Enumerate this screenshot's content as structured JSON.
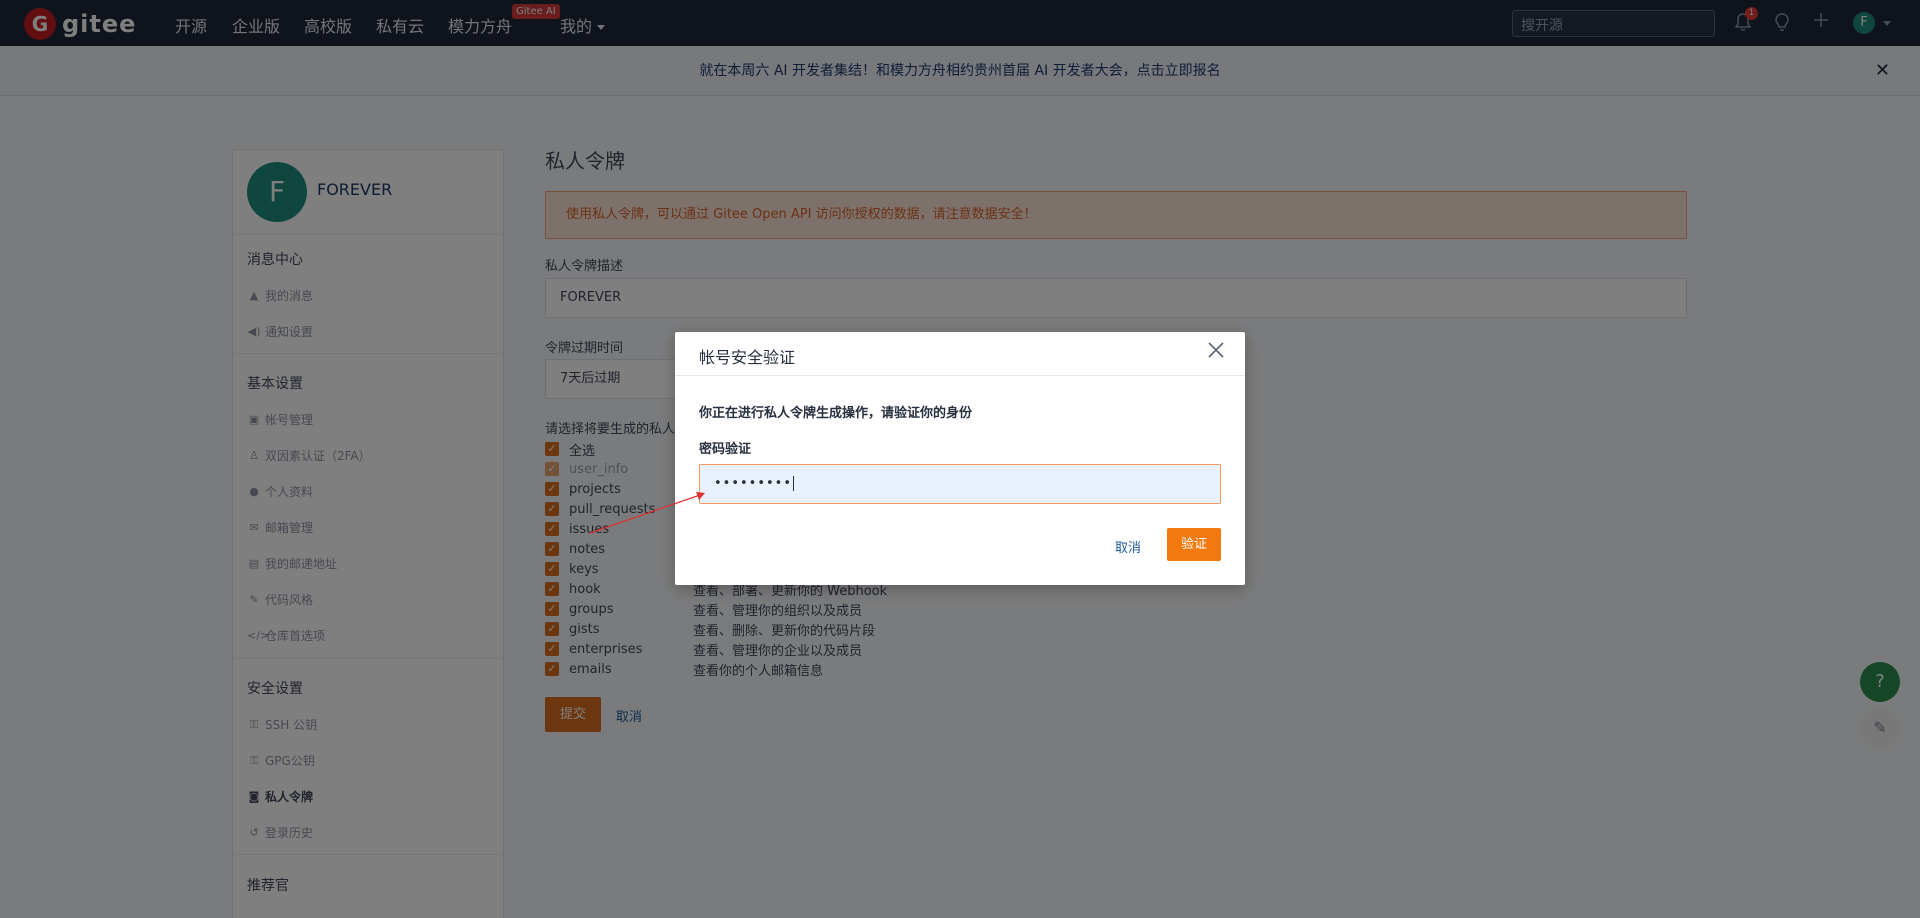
{
  "nav": {
    "logo_letter": "G",
    "logo_text": "gitee",
    "items": [
      "开源",
      "企业版",
      "高校版",
      "私有云",
      "模力方舟",
      "我的"
    ],
    "ai_badge": "Gitee AI",
    "search_placeholder": "搜开源",
    "notif_count": "1",
    "avatar_letter": "F"
  },
  "announcement": {
    "text": "就在本周六 AI 开发者集结！和模力方舟相约贵州首届 AI 开发者大会，点击立即报名",
    "close": "✕"
  },
  "sidebar": {
    "avatar_letter": "F",
    "username": "FOREVER",
    "sections": [
      {
        "title": "消息中心",
        "items": [
          {
            "icon": "bell-icon",
            "glyph": "🔔",
            "label": "我的消息"
          },
          {
            "icon": "speaker-icon",
            "glyph": "🔈",
            "label": "通知设置"
          }
        ]
      },
      {
        "title": "基本设置",
        "items": [
          {
            "icon": "id-card-icon",
            "glyph": "▣",
            "label": "帐号管理"
          },
          {
            "icon": "user-shield-icon",
            "glyph": "⚇",
            "label": "双因素认证（2FA）"
          },
          {
            "icon": "user-icon",
            "glyph": "●",
            "label": "个人资料"
          },
          {
            "icon": "mail-icon",
            "glyph": "✉",
            "label": "邮箱管理"
          },
          {
            "icon": "address-icon",
            "glyph": "▤",
            "label": "我的邮递地址"
          },
          {
            "icon": "brush-icon",
            "glyph": "✎",
            "label": "代码风格"
          },
          {
            "icon": "code-icon",
            "glyph": "</>",
            "label": "仓库首选项"
          }
        ]
      },
      {
        "title": "安全设置",
        "items": [
          {
            "icon": "key-icon",
            "glyph": "⚿",
            "label": "SSH 公钥"
          },
          {
            "icon": "key-icon",
            "glyph": "⚿",
            "label": "GPG公钥"
          },
          {
            "icon": "lock-icon",
            "glyph": "🔒",
            "label": "私人令牌"
          },
          {
            "icon": "history-icon",
            "glyph": "↺",
            "label": "登录历史"
          }
        ]
      },
      {
        "title": "推荐官",
        "items": []
      }
    ]
  },
  "main": {
    "title": "私人令牌",
    "alert": "使用私人令牌，可以通过 Gitee Open API 访问你授权的数据，请注意数据安全！",
    "desc_label": "私人令牌描述",
    "desc_value": "FOREVER",
    "expiry_label": "令牌过期时间",
    "expiry_value": "7天后过期",
    "scope_label": "请选择将要生成的私人",
    "scopes": [
      {
        "name": "全选",
        "desc": "",
        "disabled": false
      },
      {
        "name": "user_info",
        "desc": "",
        "disabled": true
      },
      {
        "name": "projects",
        "desc": "",
        "disabled": false
      },
      {
        "name": "pull_requests",
        "desc": "",
        "disabled": false
      },
      {
        "name": "issues",
        "desc": "",
        "disabled": false
      },
      {
        "name": "notes",
        "desc": "",
        "disabled": false
      },
      {
        "name": "keys",
        "desc": "",
        "disabled": false
      },
      {
        "name": "hook",
        "desc": "查看、部署、更新你的 Webhook",
        "disabled": false
      },
      {
        "name": "groups",
        "desc": "查看、管理你的组织以及成员",
        "disabled": false
      },
      {
        "name": "gists",
        "desc": "查看、删除、更新你的代码片段",
        "disabled": false
      },
      {
        "name": "enterprises",
        "desc": "查看、管理你的企业以及成员",
        "disabled": false
      },
      {
        "name": "emails",
        "desc": "查看你的个人邮箱信息",
        "disabled": false
      }
    ],
    "submit": "提交",
    "cancel": "取消"
  },
  "modal": {
    "title": "帐号安全验证",
    "message": "你正在进行私人令牌生成操作，请验证你的身份",
    "password_label": "密码验证",
    "password_value": "•••••••••",
    "cancel": "取消",
    "verify": "验证"
  },
  "float": {
    "help": "?",
    "edit": "✎"
  }
}
